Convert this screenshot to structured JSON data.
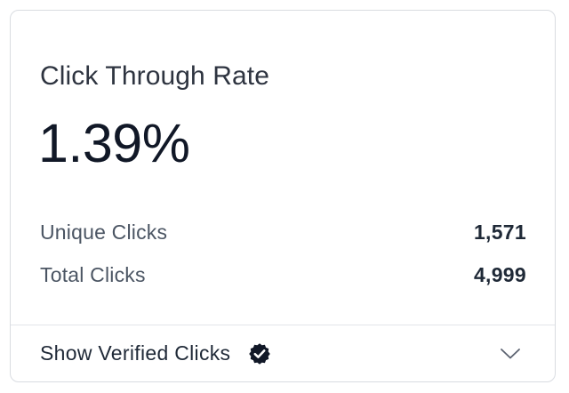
{
  "card": {
    "title": "Click Through Rate",
    "value": "1.39%",
    "stats": [
      {
        "label": "Unique Clicks",
        "value": "1,571"
      },
      {
        "label": "Total Clicks",
        "value": "4,999"
      }
    ],
    "footer": {
      "label": "Show Verified Clicks",
      "icon": "verified-badge-icon",
      "toggle_icon": "chevron-down-icon"
    }
  },
  "colors": {
    "title": "#2e3440",
    "value": "#111827",
    "label": "#4b5563",
    "border": "#d9dce1",
    "badge": "#111827"
  }
}
